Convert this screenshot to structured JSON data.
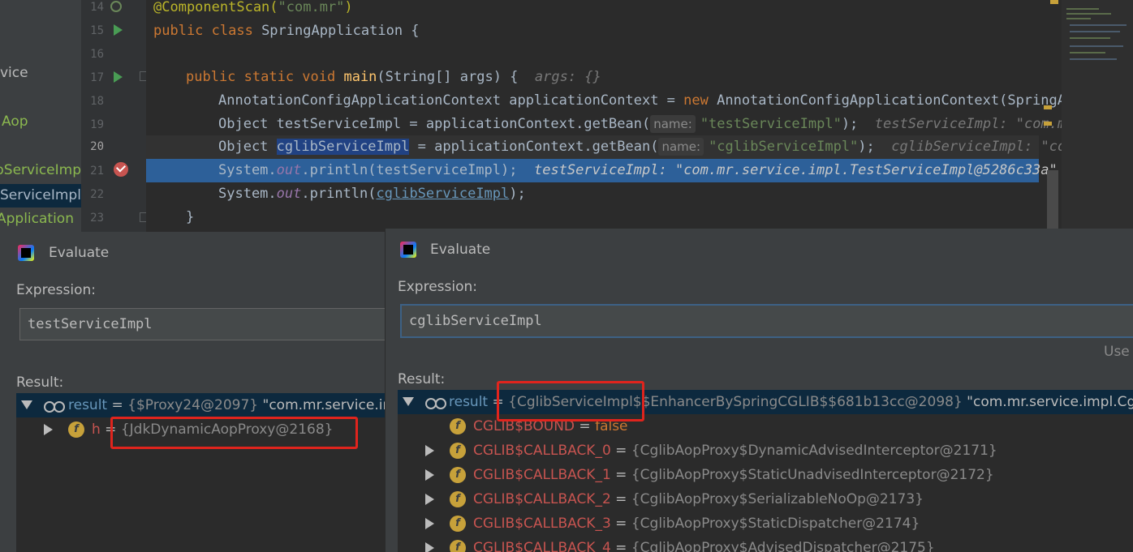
{
  "sidebar": {
    "items": [
      {
        "label": "vice",
        "color": "#bbbbbb"
      },
      {
        "label": "Aop",
        "color": "#8bb84f"
      },
      {
        "label": "bServiceImp",
        "color": "#8bb84f"
      },
      {
        "label": "ServiceImpl",
        "color": "#a9b7c6"
      },
      {
        "label": "Application",
        "color": "#8bb84f"
      }
    ]
  },
  "gutter": {
    "line_numbers": [
      "14",
      "15",
      "16",
      "17",
      "18",
      "19",
      "20",
      "21",
      "22",
      "23"
    ]
  },
  "editor": {
    "l14": {
      "ann": "@ComponentScan(",
      "str": "\"com.mr\"",
      "close": ")"
    },
    "l15": {
      "kw": "public class ",
      "rest": "SpringApplication {"
    },
    "l17": {
      "kw": "public static void ",
      "method": "main",
      "rest": "(String[] args) {  ",
      "hint": "args: {}"
    },
    "l18": {
      "pre": "AnnotationConfigApplicationContext applicationContext = ",
      "kw": "new ",
      "rest": "AnnotationConfigApplicationContext(SpringApp"
    },
    "l19": {
      "pre": "Object testServiceImpl = applicationContext.getBean(",
      "param": "name:",
      "str": "\"testServiceImpl\"",
      "post": ");",
      "dbg": "testServiceImpl: \"com.mr"
    },
    "l20": {
      "pre": "Object ",
      "sel": "cglibServiceImpl",
      "mid": " = applicationContext.getBean(",
      "param": "name:",
      "str": "\"cglibServiceImpl\"",
      "post": ");",
      "dbg": "cglibServiceImpl: \"com"
    },
    "l21": {
      "pre": "System.",
      "field": "out",
      "post": ".println(testServiceImpl);",
      "dbg": "testServiceImpl: \"com.mr.service.impl.TestServiceImpl@5286c33a\""
    },
    "l22": {
      "pre": "System.",
      "field": "out",
      "mid": ".println(",
      "link": "cglibServiceImpl",
      "post": ");"
    },
    "l23": {
      "text": "}"
    }
  },
  "dialog_left": {
    "title": "Evaluate",
    "expression_label": "Expression:",
    "expression_value": "testServiceImpl",
    "result_label": "Result:",
    "rows": [
      {
        "name": "result",
        "eq": " = ",
        "val": "{$Proxy24@2097}",
        "extra": " \"com.mr.service.impl"
      },
      {
        "name": "h",
        "eq": " = ",
        "val": "{JdkDynamicAopProxy@2168}"
      }
    ]
  },
  "dialog_right": {
    "title": "Evaluate",
    "expression_label": "Expression:",
    "expression_value": "cglibServiceImpl",
    "use_label": "Use",
    "result_label": "Result:",
    "rows": [
      {
        "name": "result",
        "eq": " = ",
        "val": "{CglibServiceImpl$$EnhancerBySpringCGLIB$$681b13cc@2098}",
        "extra": " \"com.mr.service.impl.CglibServ"
      },
      {
        "name": "CGLIB$BOUND",
        "eq": " = ",
        "val": "false"
      },
      {
        "name": "CGLIB$CALLBACK_0",
        "eq": " = ",
        "val": "{CglibAopProxy$DynamicAdvisedInterceptor@2171}"
      },
      {
        "name": "CGLIB$CALLBACK_1",
        "eq": " = ",
        "val": "{CglibAopProxy$StaticUnadvisedInterceptor@2172}"
      },
      {
        "name": "CGLIB$CALLBACK_2",
        "eq": " = ",
        "val": "{CglibAopProxy$SerializableNoOp@2173}"
      },
      {
        "name": "CGLIB$CALLBACK_3",
        "eq": " = ",
        "val": "{CglibAopProxy$StaticDispatcher@2174}"
      },
      {
        "name": "CGLIB$CALLBACK_4",
        "eq": " = ",
        "val": "{CglibAopProxy$AdvisedDispatcher@2175}"
      }
    ]
  },
  "icons": {
    "field": "f",
    "run": "run-gutter-icon",
    "breakpoint": "breakpoint-icon",
    "watch": "glasses-icon"
  },
  "colors": {
    "highlight_line": "#2d6099",
    "annotation_box": "#e0241d",
    "field_icon": "#c7a13a"
  }
}
